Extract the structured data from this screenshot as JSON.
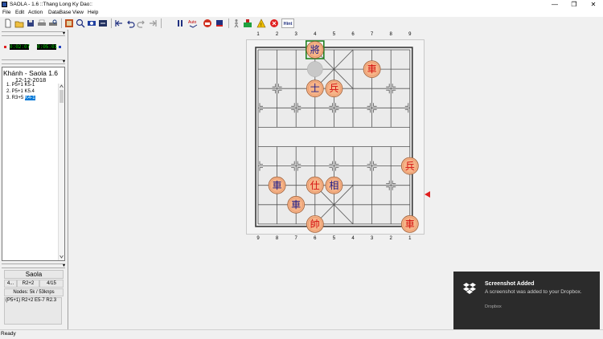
{
  "window": {
    "title": "SAOLA - 1.6 ::Thang Long Ky Dao::",
    "minimize_glyph": "—",
    "maximize_glyph": "❐",
    "close_glyph": "✕"
  },
  "menu": [
    "File",
    "Edit",
    "Action",
    "DataBase",
    "View",
    "Help"
  ],
  "toolbar": {
    "hint_label": "Hint",
    "auto_label": "Auto",
    "icons": [
      "new-file-icon",
      "open-folder-icon",
      "save-icon",
      "print-icon",
      "print-preview-icon",
      "setup-board-icon",
      "search-icon",
      "engine-icon",
      "flip-board-icon",
      "first-move-icon",
      "undo-icon",
      "redo-icon",
      "last-move-icon",
      "pause-icon",
      "auto-play-icon",
      "red-side-icon",
      "black-side-icon",
      "walk-icon",
      "engine-analyze-icon",
      "warning-icon",
      "stop-icon",
      "hint-icon"
    ]
  },
  "clocks": {
    "red_time": "0:02:07",
    "black_time": "0:05:01"
  },
  "game": {
    "title": "Khánh - Saola 1.6",
    "date": "12-12-2018",
    "moves": [
      {
        "text": "1. P5+1 K5-1"
      },
      {
        "text": "2. P5+1 K5.4"
      },
      {
        "prefix": "3. R3+5",
        "selected": "K4-1"
      }
    ]
  },
  "engine": {
    "name": "Saola",
    "depth": "4...",
    "best_move": "R2+2",
    "progress": "4/15",
    "nodes": "Nodes: 5k / 53knps",
    "pv": "(P5+1) R2+2 E5-7 R2.3"
  },
  "board": {
    "file_labels_top": [
      "1",
      "2",
      "3",
      "4",
      "5",
      "6",
      "7",
      "8",
      "9"
    ],
    "file_labels_bottom": [
      "9",
      "8",
      "7",
      "6",
      "5",
      "4",
      "3",
      "2",
      "1"
    ],
    "last_move_from": [
      3,
      1
    ],
    "last_move_to": [
      3,
      0
    ],
    "pieces": [
      {
        "name": "black-general",
        "glyph": "將",
        "side": "black",
        "col": 3,
        "row": 0,
        "highlight": true
      },
      {
        "name": "red-chariot",
        "glyph": "車",
        "side": "red",
        "col": 6,
        "row": 1
      },
      {
        "name": "black-advisor",
        "glyph": "士",
        "side": "black",
        "col": 3,
        "row": 2
      },
      {
        "name": "red-soldier",
        "glyph": "兵",
        "side": "red",
        "col": 4,
        "row": 2
      },
      {
        "name": "red-soldier",
        "glyph": "兵",
        "side": "red",
        "col": 8,
        "row": 6
      },
      {
        "name": "black-chariot",
        "glyph": "車",
        "side": "black",
        "col": 1,
        "row": 7
      },
      {
        "name": "red-advisor",
        "glyph": "仕",
        "side": "red",
        "col": 3,
        "row": 7
      },
      {
        "name": "black-elephant",
        "glyph": "相",
        "side": "black",
        "col": 4,
        "row": 7
      },
      {
        "name": "black-chariot",
        "glyph": "車",
        "side": "black",
        "col": 2,
        "row": 8
      },
      {
        "name": "red-general",
        "glyph": "帥",
        "side": "red",
        "col": 3,
        "row": 9
      },
      {
        "name": "red-chariot",
        "glyph": "車",
        "side": "red",
        "col": 8,
        "row": 9
      }
    ]
  },
  "status": "Ready",
  "toast": {
    "title": "Screenshot Added",
    "body": "A screenshot was added to your Dropbox.",
    "source": "Dropbox"
  },
  "colors": {
    "piece_fill": "#f6b488",
    "red_ink": "#d41010",
    "black_ink": "#1a1a8a",
    "selection": "#0078d7",
    "clock_text": "#00e000",
    "toast_bg": "#2b2b2b"
  }
}
